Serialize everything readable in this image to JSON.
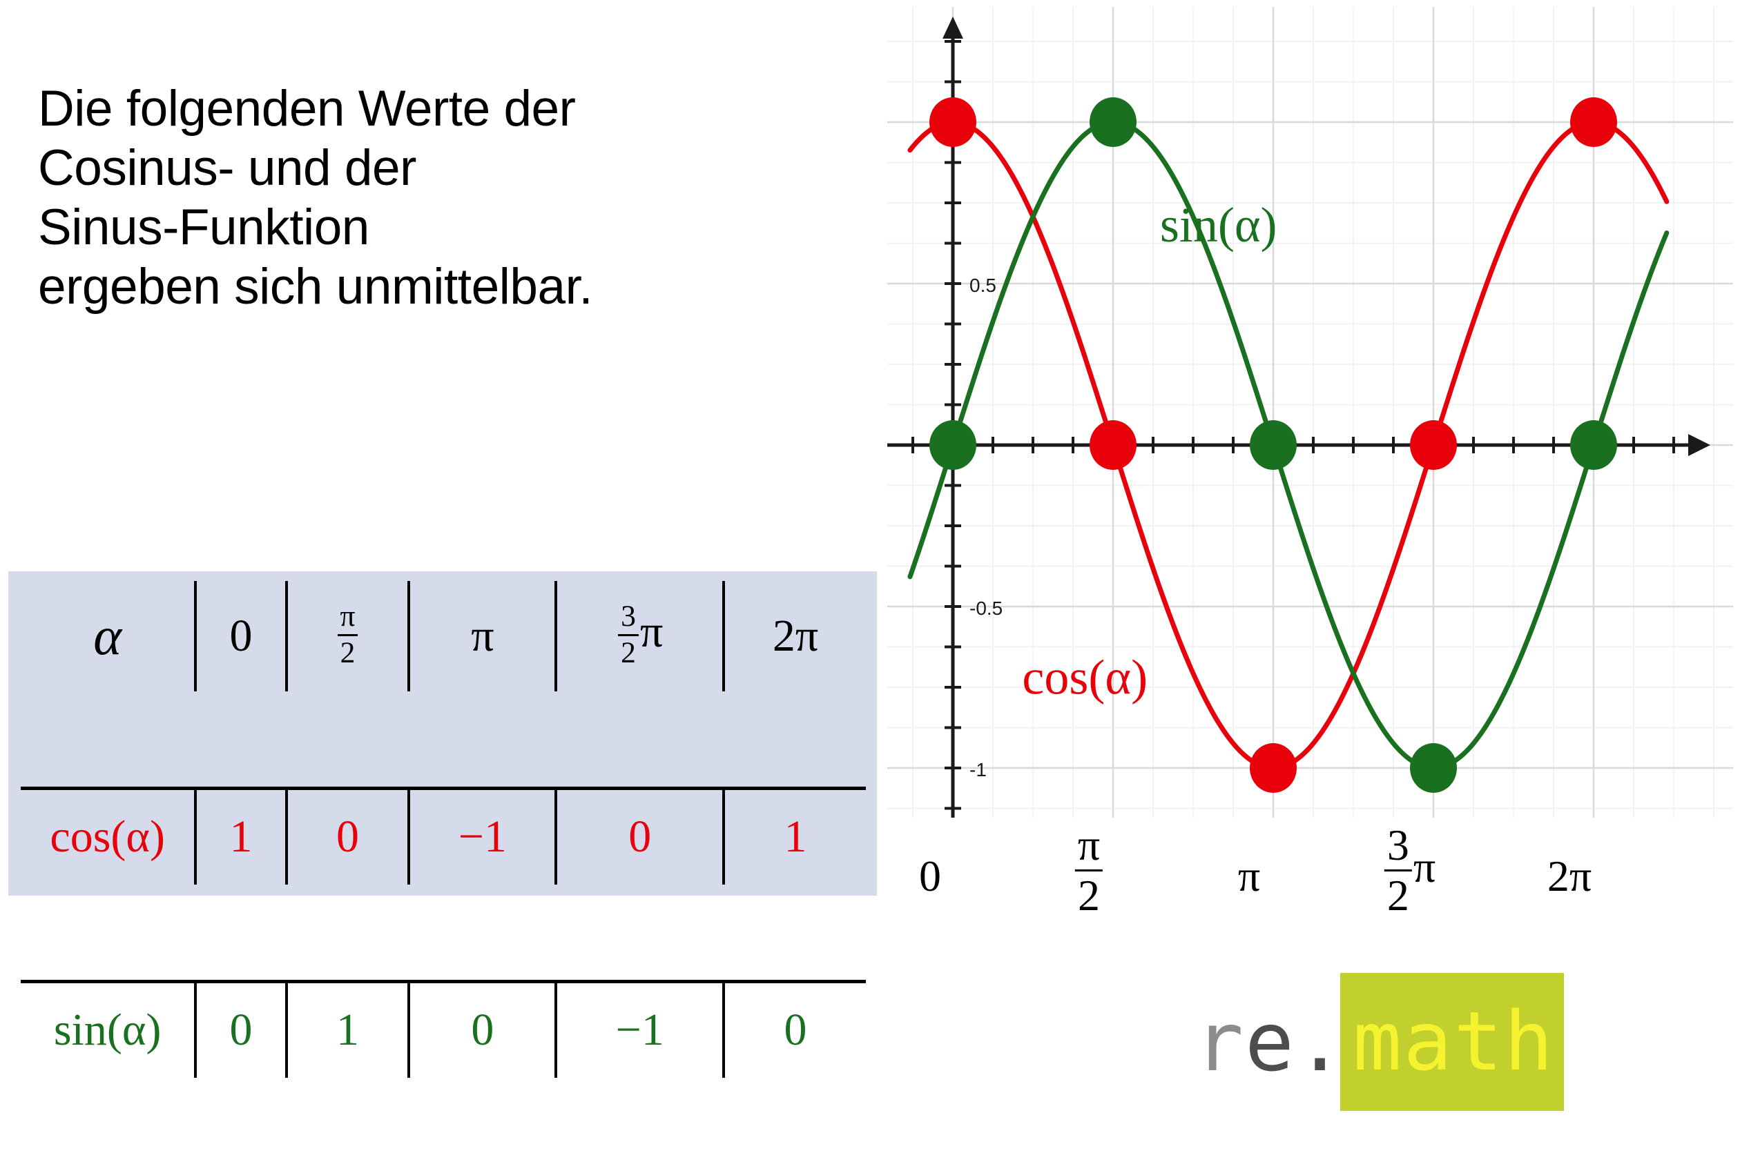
{
  "prose": {
    "lines": [
      "Die folgenden Werte der",
      "Cosinus- und der",
      "Sinus-Funktion",
      "ergeben sich unmittelbar."
    ]
  },
  "value_table": {
    "row_labels": [
      "α",
      "cos(α)",
      "sin(α)"
    ],
    "angle_headers": [
      "0",
      "π/2",
      "π",
      "3/2 π",
      "2π"
    ],
    "angle_parts": [
      {
        "kind": "plain",
        "text": "0"
      },
      {
        "kind": "frac",
        "num": "π",
        "den": "2",
        "suffix": ""
      },
      {
        "kind": "plain",
        "text": "π"
      },
      {
        "kind": "frac",
        "num": "3",
        "den": "2",
        "suffix": "π"
      },
      {
        "kind": "plain",
        "text": "2π"
      }
    ],
    "cos_label": "cos(α)",
    "sin_label": "sin(α)",
    "cos_values": [
      "1",
      "0",
      "−1",
      "0",
      "1"
    ],
    "sin_values": [
      "0",
      "1",
      "0",
      "−1",
      "0"
    ],
    "background": "#d5dbeb",
    "cos_color": "#e8000b",
    "sin_color": "#19711f"
  },
  "chart_data": {
    "type": "line",
    "title": "",
    "xlabel": "",
    "ylabel": "",
    "xlim": [
      -0.25,
      7.1
    ],
    "ylim": [
      -1.28,
      1.35
    ],
    "grid": true,
    "legend": "inline-annotation",
    "x_tick_labels": [
      "0",
      "π/2",
      "π",
      "3/2 π",
      "2π"
    ],
    "x_tick_values": [
      0,
      1.5708,
      3.1416,
      4.7124,
      6.2832
    ],
    "y_tick_labels": [
      "0.5",
      "-0.5",
      "-1"
    ],
    "y_tick_values": [
      0.5,
      -0.5,
      -1
    ],
    "series": [
      {
        "name": "cos(α)",
        "color": "#e8000b",
        "annotation": "cos(α)",
        "marked_points": [
          {
            "x": 0,
            "y": 1
          },
          {
            "x": 1.5708,
            "y": 0
          },
          {
            "x": 3.1416,
            "y": -1
          },
          {
            "x": 4.7124,
            "y": 0
          },
          {
            "x": 6.2832,
            "y": 1
          }
        ]
      },
      {
        "name": "sin(α)",
        "color": "#19711f",
        "annotation": "sin(α)",
        "marked_points": [
          {
            "x": 0,
            "y": 0
          },
          {
            "x": 1.5708,
            "y": 1
          },
          {
            "x": 3.1416,
            "y": 0
          },
          {
            "x": 4.7124,
            "y": -1
          },
          {
            "x": 6.2832,
            "y": 0
          }
        ]
      }
    ]
  },
  "logo": {
    "prefix_r": "r",
    "prefix_e": "e",
    "dot": ".",
    "word": "math",
    "box_color": "#c2d02e",
    "word_color": "#f5f230",
    "prefix_color": "#8c8c8c"
  }
}
